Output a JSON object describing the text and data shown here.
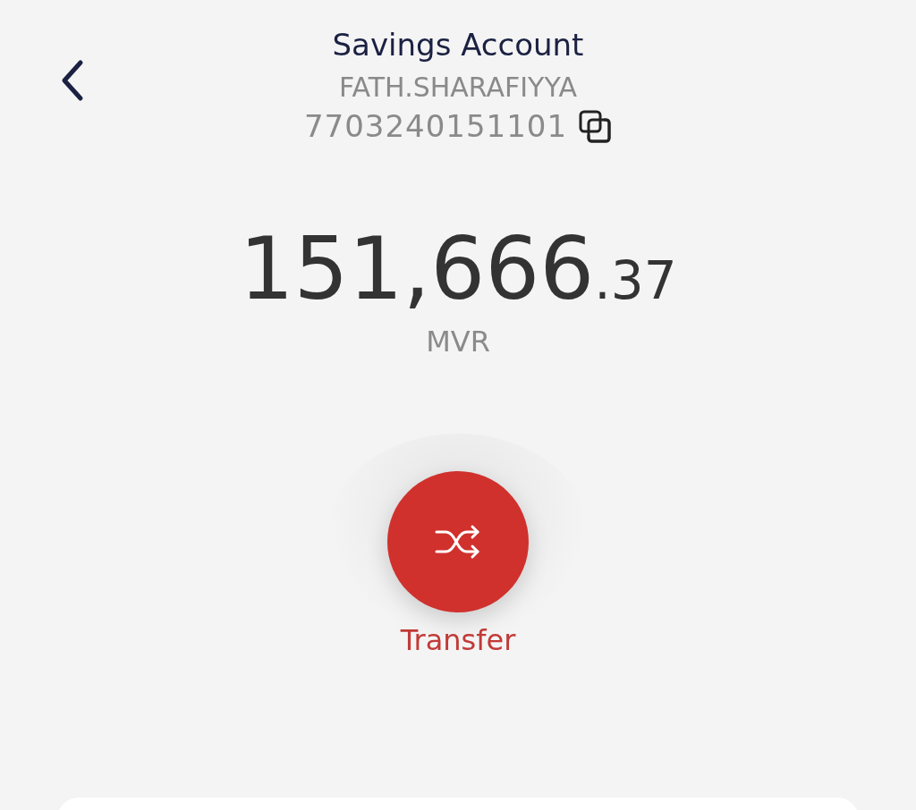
{
  "header": {
    "title": "Savings Account",
    "holder_name": "FATH.SHARAFIYYA",
    "account_number": "7703240151101"
  },
  "balance": {
    "whole": "151,666",
    "fraction": ".37",
    "currency": "MVR"
  },
  "action": {
    "label": "Transfer"
  }
}
